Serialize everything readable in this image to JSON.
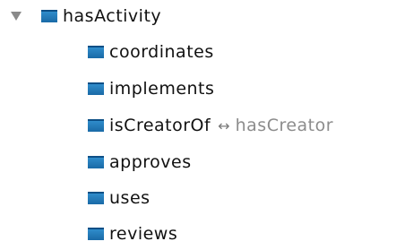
{
  "tree": {
    "root": {
      "label": "hasActivity",
      "expanded": true,
      "toggle_icon": "triangle-down-icon",
      "icon": "object-property-icon"
    },
    "children": [
      {
        "label": "coordinates",
        "icon": "object-property-icon"
      },
      {
        "label": "implements",
        "icon": "object-property-icon"
      },
      {
        "label": "isCreatorOf",
        "icon": "object-property-icon",
        "inverse_symbol": "↔",
        "inverse_label": "hasCreator"
      },
      {
        "label": "approves",
        "icon": "object-property-icon"
      },
      {
        "label": "uses",
        "icon": "object-property-icon"
      },
      {
        "label": "reviews",
        "icon": "object-property-icon"
      }
    ]
  },
  "colors": {
    "icon_fill": "#1f78b8",
    "icon_border": "#0d4f86",
    "text": "#111111",
    "inverse_text": "#8c8c8c",
    "toggle": "#8a8a8a"
  }
}
